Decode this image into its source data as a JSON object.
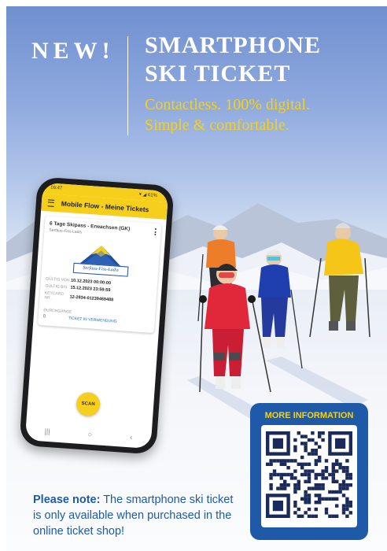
{
  "headline": {
    "badge": "NEW!",
    "title_line1": "SMARTPHONE",
    "title_line2": "SKI TICKET",
    "subline1": "Contactless. 100% digital.",
    "subline2": "Simple & comfortable."
  },
  "phone": {
    "status_time": "16:47",
    "status_right": "▾ ◢ 61%",
    "app_title": "Mobile Flow - Meine Tickets",
    "ticket": {
      "name": "6 Tage Skipass - Erwachsen (GK)",
      "area": "Serfaus-Fiss-Ladis",
      "logo_text": "Serfaus-Fiss-Ladis",
      "rows": [
        {
          "label": "GÜLTIG VON",
          "value": "10.12.2023 00:00:00"
        },
        {
          "label": "GÜLTIG BIS",
          "value": "15.12.2023 23:59:59"
        },
        {
          "label": "KEYCARD NR.",
          "value": "12-2834-01239469488"
        }
      ],
      "usage_label": "DURCHGÄNGE",
      "usage_count": "0",
      "usage_status": "TICKET IN VERWENDUNG"
    },
    "scan_label": "SCAN",
    "nav": [
      "|||",
      "○",
      "‹"
    ]
  },
  "qr": {
    "label": "MORE INFORMATION"
  },
  "note": {
    "bold": "Please note:",
    "text": " The smartphone ski ticket is only available when purchased in the online ticket shop!"
  },
  "colors": {
    "accent_yellow": "#f2d21a",
    "brand_blue": "#1e5aa8",
    "app_yellow": "#f5cf1b"
  }
}
